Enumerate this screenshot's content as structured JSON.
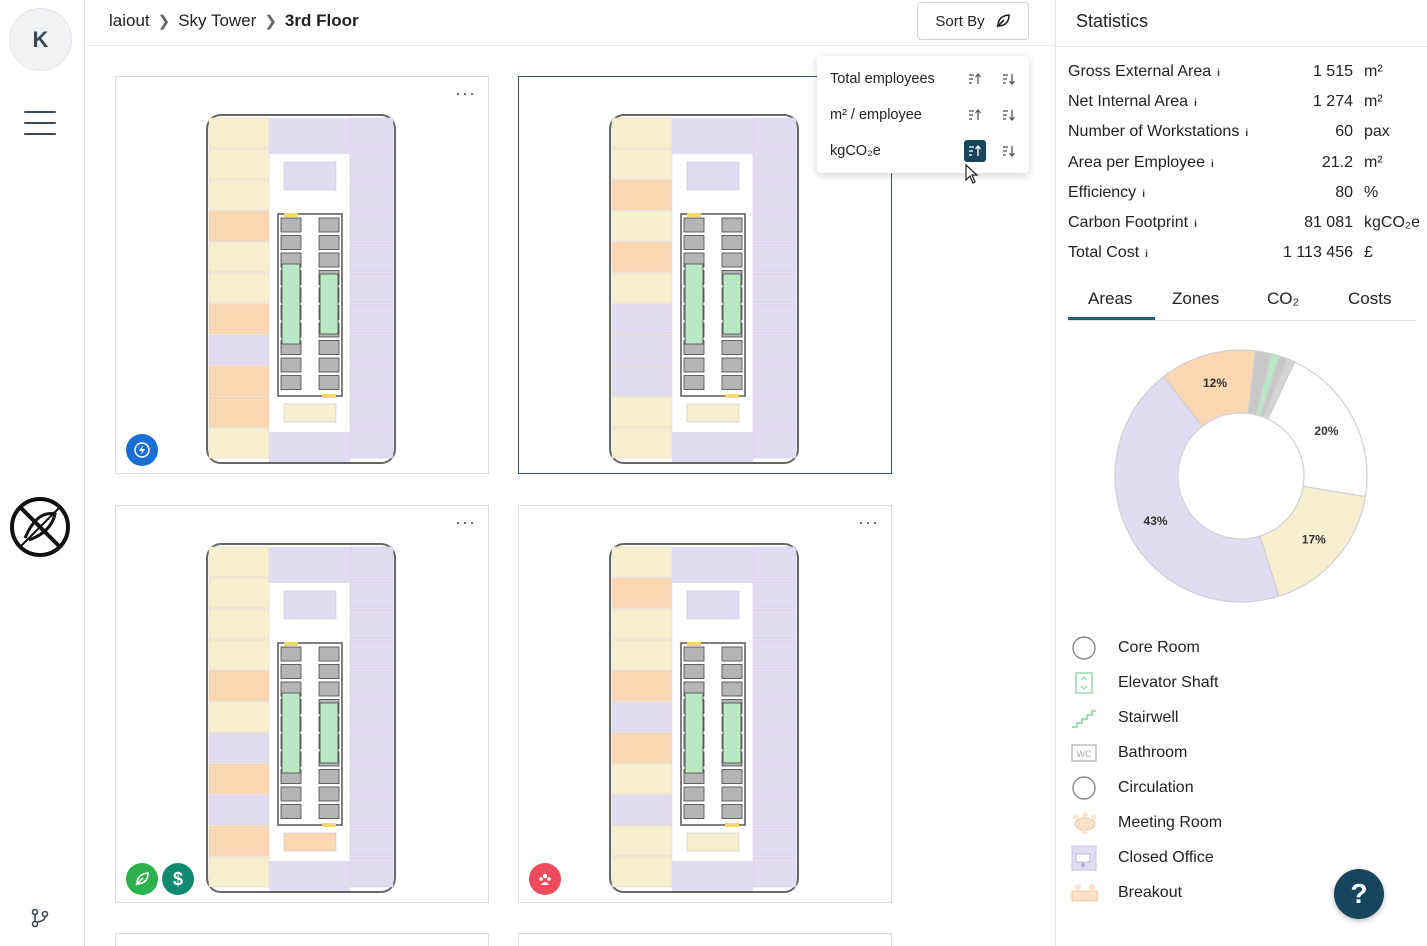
{
  "user": {
    "initial": "K"
  },
  "breadcrumb": {
    "root": "laiout",
    "building": "Sky Tower",
    "floor": "3rd Floor"
  },
  "toolbar": {
    "sort_label": "Sort By"
  },
  "sort_menu": {
    "items": [
      {
        "label_html": "Total employees",
        "active_asc": false
      },
      {
        "label_html": "m² / employee",
        "active_asc": false
      },
      {
        "label_html": "kgCO₂e",
        "active_asc": true
      }
    ]
  },
  "statistics": {
    "title": "Statistics",
    "rows": [
      {
        "label": "Gross External Area",
        "value": "1 515",
        "unit": "m²"
      },
      {
        "label": "Net Internal Area",
        "value": "1 274",
        "unit": "m²"
      },
      {
        "label": "Number of Workstations",
        "value": "60",
        "unit": "pax"
      },
      {
        "label": "Area per Employee",
        "value": "21.2",
        "unit": "m²"
      },
      {
        "label": "Efficiency",
        "value": "80",
        "unit": "%"
      },
      {
        "label": "Carbon Footprint",
        "value": "81 081",
        "unit": "kgCO₂e"
      },
      {
        "label": "Total Cost",
        "value": "1 113 456",
        "unit": "£"
      }
    ],
    "info_glyph": "i"
  },
  "tabs": [
    "Areas",
    "Zones",
    "CO₂",
    "Costs"
  ],
  "active_tab": "Areas",
  "chart_data": {
    "type": "pie",
    "donut": true,
    "slices": [
      {
        "label": "43%",
        "value": 43,
        "color": "#e2dcf3"
      },
      {
        "label": "12%",
        "value": 12,
        "color": "#fbd7b4"
      },
      {
        "label": "",
        "value": 2,
        "color": "#c8c8c8"
      },
      {
        "label": "",
        "value": 1,
        "color": "#b9e8c4"
      },
      {
        "label": "",
        "value": 1,
        "color": "#c8c8c8"
      },
      {
        "label": "",
        "value": 1,
        "color": "#d4d4d4"
      },
      {
        "label": "20%",
        "value": 20,
        "color": "#ffffff"
      },
      {
        "label": "17%",
        "value": 17,
        "color": "#f7f0d0"
      }
    ]
  },
  "legend": [
    {
      "label": "Core Room",
      "icon": "core-room-icon"
    },
    {
      "label": "Elevator Shaft",
      "icon": "elevator-shaft-icon"
    },
    {
      "label": "Stairwell",
      "icon": "stairwell-icon"
    },
    {
      "label": "Bathroom",
      "icon": "bathroom-icon"
    },
    {
      "label": "Circulation",
      "icon": "circulation-icon"
    },
    {
      "label": "Meeting Room",
      "icon": "meeting-room-icon"
    },
    {
      "label": "Closed Office",
      "icon": "closed-office-icon"
    },
    {
      "label": "Breakout",
      "icon": "breakout-icon"
    }
  ],
  "icon_labels": {
    "bathroom": "WC"
  },
  "help": {
    "label": "?"
  },
  "card_menu": "···",
  "colors": {
    "accent": "#17455e",
    "workspace": "#e2dcf3",
    "meeting": "#fbd7b4",
    "breakout": "#f7f0d0",
    "core": "#c8c8c8",
    "stair": "#b9e8c4",
    "badge_energy": "#1a6fd6",
    "badge_carbon": "#2bb24c",
    "badge_cost": "#0f8a6e",
    "badge_people": "#ee4b5d"
  }
}
